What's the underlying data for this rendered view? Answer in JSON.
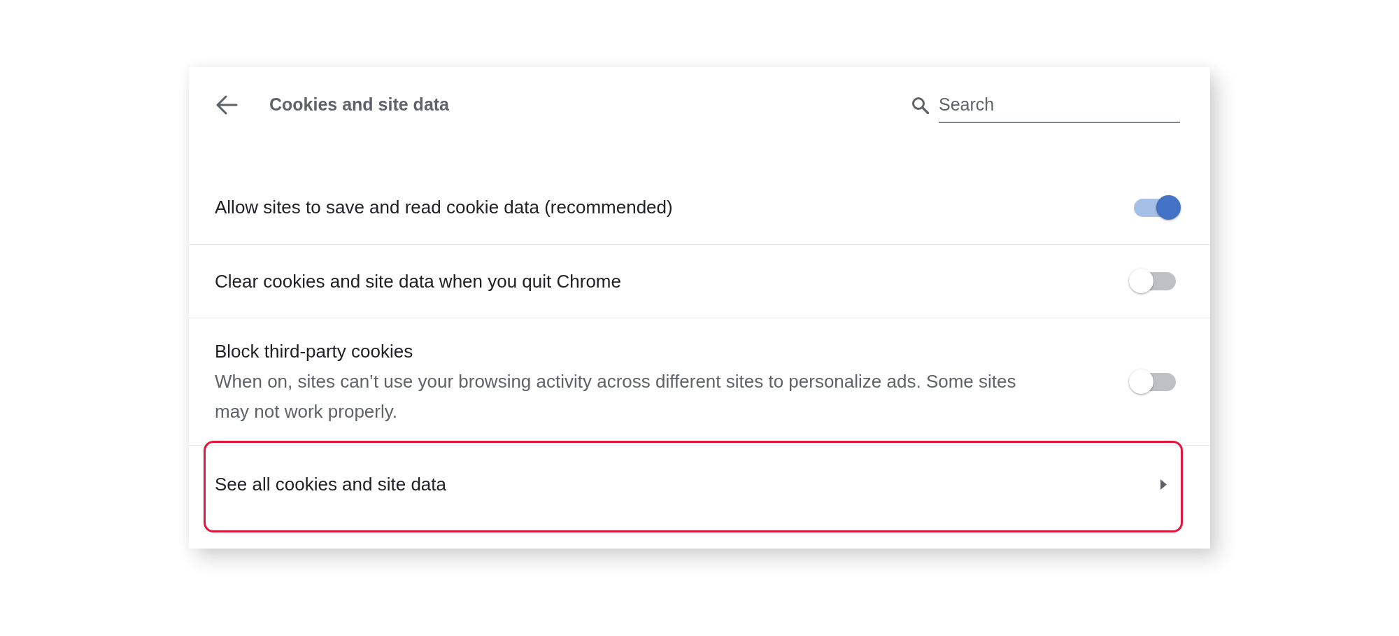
{
  "header": {
    "title": "Cookies and site data",
    "search": {
      "placeholder": "Search"
    }
  },
  "settings": [
    {
      "kind": "toggle",
      "label": "Allow sites to save and read cookie data (recommended)",
      "on": true,
      "highlighted": false
    },
    {
      "kind": "toggle",
      "label": "Clear cookies and site data when you quit Chrome",
      "on": false,
      "highlighted": false
    },
    {
      "kind": "toggle",
      "label": "Block third-party cookies",
      "description": "When on, sites can’t use your browsing activity across different sites to personalize ads. Some sites may not work properly.",
      "on": false,
      "highlighted": false
    },
    {
      "kind": "link",
      "label": "See all cookies and site data",
      "highlighted": true
    }
  ]
}
